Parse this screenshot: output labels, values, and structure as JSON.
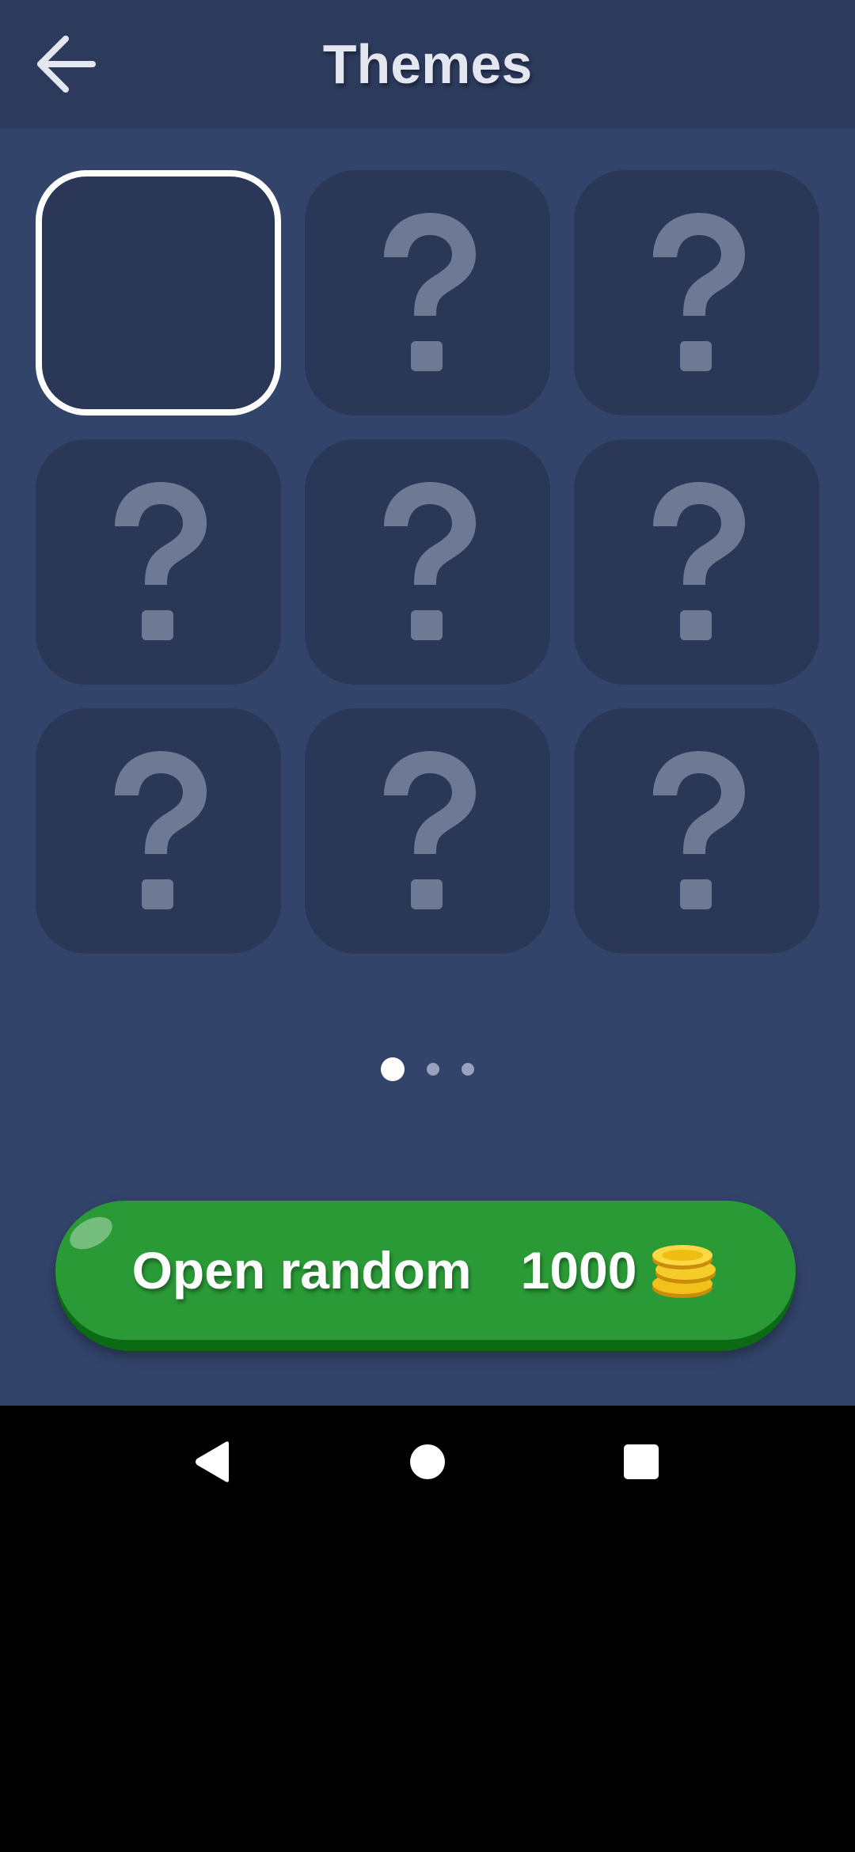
{
  "header": {
    "title": "Themes",
    "back_icon": "arrow-left-icon"
  },
  "themes": {
    "tiles": [
      {
        "state": "selected",
        "icon": ""
      },
      {
        "state": "locked",
        "icon": "question-mark-icon"
      },
      {
        "state": "locked",
        "icon": "question-mark-icon"
      },
      {
        "state": "locked",
        "icon": "question-mark-icon"
      },
      {
        "state": "locked",
        "icon": "question-mark-icon"
      },
      {
        "state": "locked",
        "icon": "question-mark-icon"
      },
      {
        "state": "locked",
        "icon": "question-mark-icon"
      },
      {
        "state": "locked",
        "icon": "question-mark-icon"
      },
      {
        "state": "locked",
        "icon": "question-mark-icon"
      }
    ]
  },
  "pager": {
    "pages": 3,
    "current": 1
  },
  "open_random": {
    "label": "Open random",
    "price": "1000",
    "icon": "coins-icon"
  },
  "navbar": {
    "back_icon": "nav-back-icon",
    "home_icon": "nav-home-icon",
    "recents_icon": "nav-recents-icon"
  },
  "colors": {
    "background": "#33446b",
    "header": "#2c3a5c",
    "tile": "#2b3756",
    "question_mark": "#6e7994",
    "button_green": "#2a9a36",
    "button_green_dark": "#0b6a14"
  }
}
